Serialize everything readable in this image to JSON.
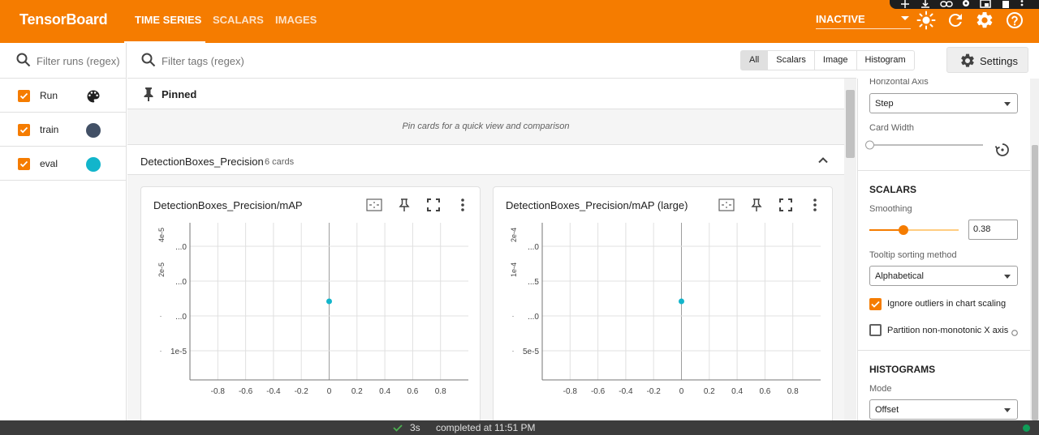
{
  "app": {
    "title": "TensorBoard",
    "tabs": [
      {
        "label": "TIME SERIES",
        "active": true
      },
      {
        "label": "SCALARS",
        "active": false
      },
      {
        "label": "IMAGES",
        "active": false
      }
    ],
    "status_select": "INACTIVE",
    "icons": [
      "brightness-icon",
      "refresh-icon",
      "settings-gear-icon",
      "help-icon"
    ]
  },
  "runs": {
    "filter_placeholder": "Filter runs (regex)",
    "items": [
      {
        "label": "Run",
        "checked": true,
        "icon": "palette-icon"
      },
      {
        "label": "train",
        "checked": true,
        "color": "#425066"
      },
      {
        "label": "eval",
        "checked": true,
        "color": "#12b5cb"
      }
    ]
  },
  "tags": {
    "filter_placeholder": "Filter tags (regex)",
    "types": [
      "All",
      "Scalars",
      "Image",
      "Histogram"
    ],
    "selected_type": "All"
  },
  "settings_button": "Settings",
  "pinned": {
    "title": "Pinned",
    "empty_text": "Pin cards for a quick view and comparison"
  },
  "group": {
    "name": "DetectionBoxes_Precision",
    "count": "6 cards"
  },
  "cards": [
    {
      "title": "DetectionBoxes_Precision/mAP"
    },
    {
      "title": "DetectionBoxes_Precision/mAP (large)"
    }
  ],
  "chart_data": [
    {
      "type": "scatter",
      "title": "DetectionBoxes_Precision/mAP",
      "x_ticks": [
        "-0.8",
        "-0.6",
        "-0.4",
        "-0.2",
        "0",
        "0.2",
        "0.4",
        "0.6",
        "0.8"
      ],
      "y_ticks": [
        {
          "exp": "4e-5",
          "label": "...0"
        },
        {
          "exp": "2e-5",
          "label": "...0"
        },
        {
          "exp": "",
          "label": "...0"
        },
        {
          "exp": "",
          "label": "1e-5"
        }
      ],
      "xlim": [
        -1,
        1
      ],
      "series": [
        {
          "x": [
            0
          ],
          "y": [
            0.5
          ],
          "color": "#12b5cb"
        }
      ]
    },
    {
      "type": "scatter",
      "title": "DetectionBoxes_Precision/mAP (large)",
      "x_ticks": [
        "-0.8",
        "-0.6",
        "-0.4",
        "-0.2",
        "0",
        "0.2",
        "0.4",
        "0.6",
        "0.8"
      ],
      "y_ticks": [
        {
          "exp": "2e-4",
          "label": "...0"
        },
        {
          "exp": "1e-4",
          "label": "...5"
        },
        {
          "exp": "",
          "label": "...0"
        },
        {
          "exp": "",
          "label": "5e-5"
        }
      ],
      "xlim": [
        -1,
        1
      ],
      "series": [
        {
          "x": [
            0
          ],
          "y": [
            0.5
          ],
          "color": "#12b5cb"
        }
      ]
    }
  ],
  "settings": {
    "horizontal_axis_label": "Horizontal Axis",
    "horizontal_axis_value": "Step",
    "card_width_label": "Card Width",
    "scalars_title": "SCALARS",
    "smoothing_label": "Smoothing",
    "smoothing_value": "0.38",
    "smoothing_fraction": 0.38,
    "tooltip_label": "Tooltip sorting method",
    "tooltip_value": "Alphabetical",
    "ignore_outliers_label": "Ignore outliers in chart scaling",
    "ignore_outliers_checked": true,
    "partition_label": "Partition non-monotonic X axis",
    "partition_checked": false,
    "histograms_title": "HISTOGRAMS",
    "mode_label": "Mode",
    "mode_value": "Offset"
  },
  "statusbar": {
    "duration": "3s",
    "message": "completed at 11:51 PM"
  },
  "colors": {
    "brand": "#f57c00",
    "series_eval": "#12b5cb",
    "series_train": "#425066"
  }
}
